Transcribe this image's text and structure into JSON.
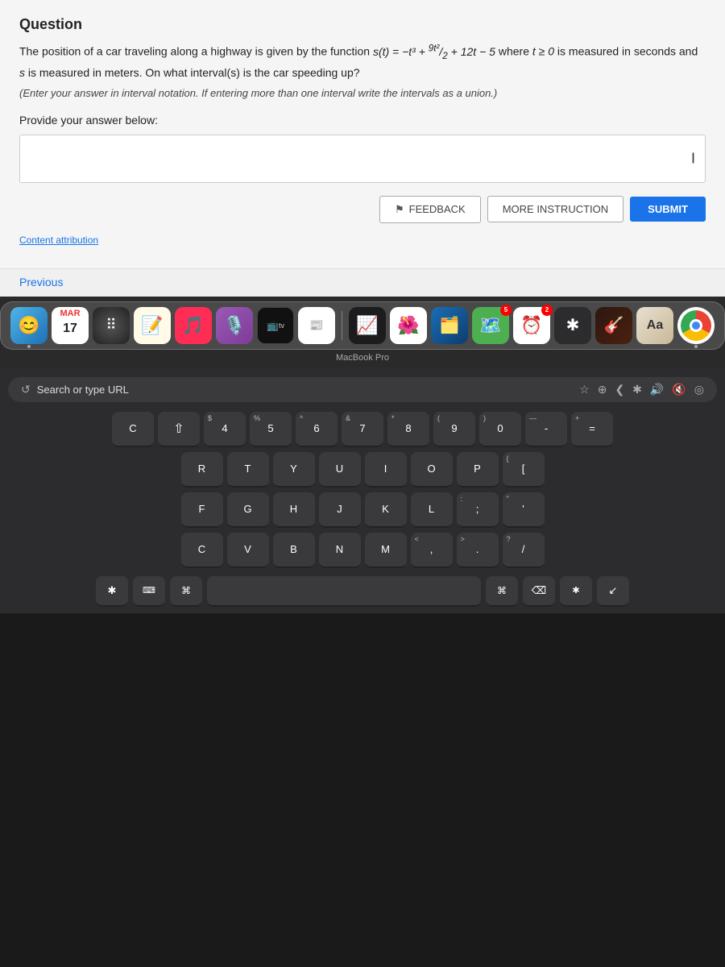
{
  "page": {
    "title": "Question"
  },
  "question": {
    "title": "Question",
    "body_text": "The position of a car traveling along a highway is given by the function s(t) = −t³ + 9t²/2 + 12t − 5 where t ≥ 0 is measured in seconds and s is measured in meters. On what interval(s) is the car speeding up?",
    "instruction": "(Enter your answer in interval notation. If entering more than one interval write the intervals as a union.)",
    "provide_label": "Provide your answer below:",
    "answer_placeholder": "",
    "buttons": {
      "feedback": "FEEDBACK",
      "more_instruction": "MORE INSTRUCTION",
      "submit": "SUBMIT"
    },
    "content_attribution": "Content attribution",
    "previous": "Previous"
  },
  "dock": {
    "label": "MacBook Pro",
    "icons": [
      {
        "name": "finder",
        "emoji": "🔵",
        "label": "Finder",
        "has_dot": true
      },
      {
        "name": "calendar",
        "emoji": "📅",
        "label": "Calendar",
        "has_dot": false,
        "badge": "17"
      },
      {
        "name": "launchpad",
        "emoji": "⬛",
        "label": "Launchpad",
        "has_dot": false
      },
      {
        "name": "notes",
        "emoji": "📝",
        "label": "Notes",
        "has_dot": false
      },
      {
        "name": "music",
        "emoji": "🎵",
        "label": "Music",
        "has_dot": false
      },
      {
        "name": "podcasts",
        "emoji": "🎙️",
        "label": "Podcasts",
        "has_dot": false
      },
      {
        "name": "appletv",
        "emoji": "📺",
        "label": "Apple TV",
        "has_dot": false
      },
      {
        "name": "news",
        "emoji": "📰",
        "label": "News",
        "has_dot": false
      },
      {
        "name": "stocks",
        "emoji": "📊",
        "label": "Stocks",
        "has_dot": false
      },
      {
        "name": "photo",
        "emoji": "🖼️",
        "label": "Photos",
        "has_dot": false
      },
      {
        "name": "keynote",
        "emoji": "🗂️",
        "label": "Keynote",
        "has_dot": false
      },
      {
        "name": "maps",
        "emoji": "🗺️",
        "label": "Maps",
        "has_dot": false,
        "badge": "5"
      },
      {
        "name": "clock",
        "emoji": "⏰",
        "label": "Clock",
        "has_dot": false,
        "badge": "2"
      },
      {
        "name": "bluetooth",
        "emoji": "✱",
        "label": "Bluetooth",
        "has_dot": false
      },
      {
        "name": "guitar",
        "emoji": "🎸",
        "label": "GarageBand",
        "has_dot": false
      },
      {
        "name": "dictionary",
        "emoji": "Aa",
        "label": "Dictionary",
        "has_dot": false
      },
      {
        "name": "chrome",
        "emoji": "🔵",
        "label": "Chrome",
        "has_dot": true
      }
    ]
  },
  "browser": {
    "address": "Search or type URL",
    "nav_icons": [
      "↺",
      "★",
      "⊕",
      "❮",
      "✱",
      "🔊",
      "🔇",
      "◎"
    ]
  },
  "keyboard": {
    "rows": [
      {
        "keys": [
          {
            "top": "",
            "main": "C",
            "wide": false
          },
          {
            "top": "",
            "main": "⇧",
            "wide": false
          },
          {
            "top": "$",
            "main": "4",
            "wide": false
          },
          {
            "top": "%",
            "main": "5",
            "wide": false
          },
          {
            "top": "^",
            "main": "6",
            "wide": false
          },
          {
            "top": "&",
            "main": "7",
            "wide": false
          },
          {
            "top": "*",
            "main": "8",
            "wide": false
          },
          {
            "top": "(",
            "main": "9",
            "wide": false
          },
          {
            "top": ")",
            "main": "0",
            "wide": false
          },
          {
            "top": "—",
            "main": "-",
            "wide": false
          },
          {
            "top": "=",
            "main": "=",
            "wide": false
          },
          {
            "top": "+",
            "main": "+",
            "wide": false
          }
        ]
      },
      {
        "keys": [
          {
            "top": "",
            "main": "R",
            "wide": false
          },
          {
            "top": "",
            "main": "T",
            "wide": false
          },
          {
            "top": "",
            "main": "Y",
            "wide": false
          },
          {
            "top": "",
            "main": "U",
            "wide": false
          },
          {
            "top": "",
            "main": "I",
            "wide": false
          },
          {
            "top": "",
            "main": "O",
            "wide": false
          },
          {
            "top": "",
            "main": "P",
            "wide": false
          },
          {
            "top": "{",
            "main": "[",
            "wide": false
          }
        ]
      },
      {
        "keys": [
          {
            "top": "",
            "main": "F",
            "wide": false
          },
          {
            "top": "",
            "main": "G",
            "wide": false
          },
          {
            "top": "",
            "main": "H",
            "wide": false
          },
          {
            "top": "",
            "main": "J",
            "wide": false
          },
          {
            "top": "",
            "main": "K",
            "wide": false
          },
          {
            "top": "",
            "main": "L",
            "wide": false
          },
          {
            "top": ":",
            "main": ";",
            "wide": false
          },
          {
            "top": "\"",
            "main": "'",
            "wide": false
          }
        ]
      },
      {
        "keys": [
          {
            "top": "",
            "main": "C",
            "wide": false
          },
          {
            "top": "",
            "main": "V",
            "wide": false
          },
          {
            "top": "",
            "main": "B",
            "wide": false
          },
          {
            "top": "",
            "main": "N",
            "wide": false
          },
          {
            "top": "",
            "main": "M",
            "wide": false
          },
          {
            "top": "<",
            "main": ",",
            "wide": false
          },
          {
            "top": ">",
            "main": ".",
            "wide": false
          },
          {
            "top": "?",
            "main": "/",
            "wide": false
          }
        ]
      }
    ],
    "bottom_row": [
      "⌘",
      "space",
      "⌘"
    ],
    "fn_keys": [
      "✱",
      "⌨",
      "⌫"
    ]
  }
}
